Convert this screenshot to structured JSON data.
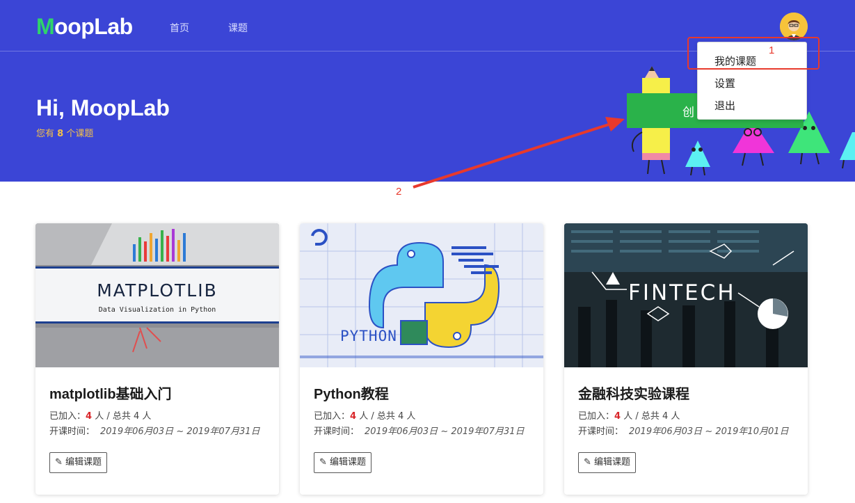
{
  "header": {
    "logo_initial": "M",
    "logo_rest": "oopLab",
    "nav": {
      "home": "首页",
      "courses": "课题"
    }
  },
  "hero": {
    "title": "Hi, MoopLab",
    "subtitle_prefix": "您有 ",
    "subtitle_count": "8",
    "subtitle_suffix": " 个课题",
    "create_button_visible_text": "创"
  },
  "user_menu": {
    "items": [
      "我的课题",
      "设置",
      "退出"
    ]
  },
  "annotations": {
    "marker_1": "1",
    "marker_2": "2",
    "highlight_color": "#e8392c"
  },
  "colors": {
    "hero_bg": "#3b45d6",
    "accent_green": "#2ab24a",
    "count_red": "#d9262a",
    "subtitle_orange": "#f3c14a"
  },
  "courses": [
    {
      "title": "matplotlib基础入门",
      "joined_label": "已加入：",
      "joined": "4",
      "joined_unit": " 人 / 总共 ",
      "total": "4",
      "total_unit": " 人",
      "date_label": "开课时间：",
      "dates": "2019年06月03日 ~ 2019年07月31日",
      "edit_label": "✎ 编辑课题",
      "thumb_title": "MATPLOTLIB",
      "thumb_subtitle": "Data Visualization in Python"
    },
    {
      "title": "Python教程",
      "joined_label": "已加入：",
      "joined": "4",
      "joined_unit": " 人 / 总共 ",
      "total": "4",
      "total_unit": " 人",
      "date_label": "开课时间：",
      "dates": "2019年06月03日 ~ 2019年07月31日",
      "edit_label": "✎ 编辑课题",
      "thumb_title": "PYTHON"
    },
    {
      "title": "金融科技实验课程",
      "joined_label": "已加入：",
      "joined": "4",
      "joined_unit": " 人 / 总共 ",
      "total": "4",
      "total_unit": " 人",
      "date_label": "开课时间：",
      "dates": "2019年06月03日 ~ 2019年10月01日",
      "edit_label": "✎ 编辑课题",
      "thumb_title": "FINTECH"
    }
  ]
}
